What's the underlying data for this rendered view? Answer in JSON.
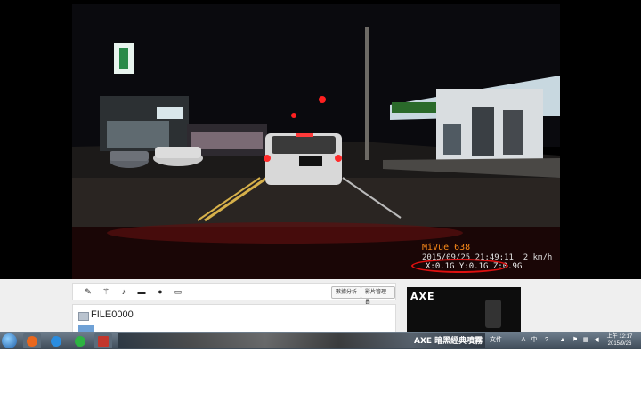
{
  "osd": {
    "model": "MiVue 638",
    "timestamp": "2015/09/25 21:49:11",
    "speed": "2 km/h",
    "gforce": "X:0.1G Y:0.1G Z:0.9G"
  },
  "toolbar": {
    "icons": [
      "pencil-icon",
      "magic-wand-icon",
      "music-note-icon",
      "comment-icon",
      "info-icon",
      "subtitle-icon"
    ],
    "button_1": "數據分析",
    "button_2": "影片管理員"
  },
  "file": {
    "name": "FILE0000"
  },
  "ad": {
    "brand": "AXE",
    "tagline": "AXE 暗黑經典噴霧"
  },
  "taskbar": {
    "tray_label": "文件",
    "time": "上午 12:17",
    "date": "2015/9/26",
    "colors": {
      "firefox": "#e8671d",
      "ie": "#2a8de0",
      "line": "#2db342",
      "app4": "#c2362c"
    }
  }
}
